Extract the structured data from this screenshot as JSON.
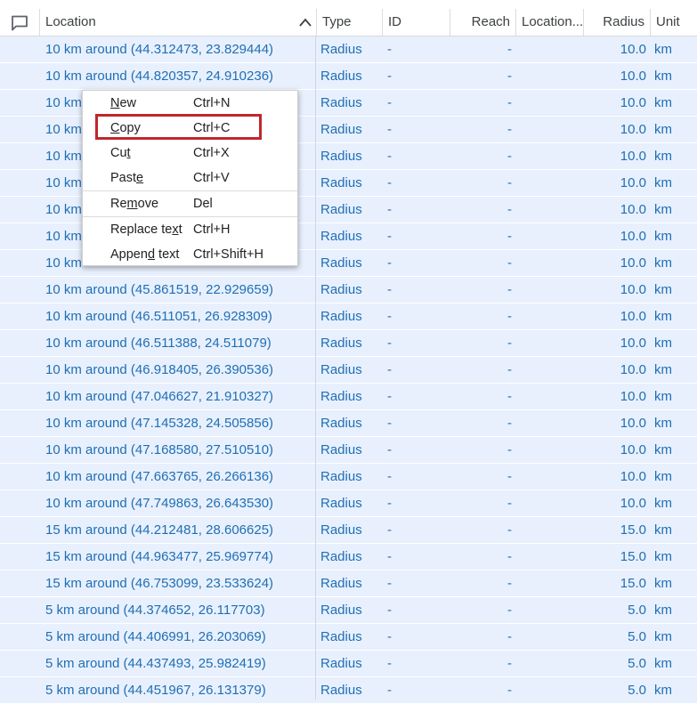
{
  "columns": {
    "location": "Location",
    "type": "Type",
    "id": "ID",
    "reach": "Reach",
    "location_groups": "Location...",
    "radius": "Radius",
    "unit": "Unit"
  },
  "rows": [
    {
      "location": "10 km around (44.312473, 23.829444)",
      "type": "Radius",
      "id": "-",
      "reach": "-",
      "radius": "10.0",
      "unit": "km"
    },
    {
      "location": "10 km around (44.820357, 24.910236)",
      "type": "Radius",
      "id": "-",
      "reach": "-",
      "radius": "10.0",
      "unit": "km"
    },
    {
      "location": "10 km",
      "type": "Radius",
      "id": "-",
      "reach": "-",
      "radius": "10.0",
      "unit": "km"
    },
    {
      "location": "10 km",
      "type": "Radius",
      "id": "-",
      "reach": "-",
      "radius": "10.0",
      "unit": "km"
    },
    {
      "location": "10 km",
      "type": "Radius",
      "id": "-",
      "reach": "-",
      "radius": "10.0",
      "unit": "km"
    },
    {
      "location": "10 km",
      "type": "Radius",
      "id": "-",
      "reach": "-",
      "radius": "10.0",
      "unit": "km"
    },
    {
      "location": "10 km",
      "type": "Radius",
      "id": "-",
      "reach": "-",
      "radius": "10.0",
      "unit": "km"
    },
    {
      "location": "10 km",
      "type": "Radius",
      "id": "-",
      "reach": "-",
      "radius": "10.0",
      "unit": "km"
    },
    {
      "location": "10 km",
      "type": "Radius",
      "id": "-",
      "reach": "-",
      "radius": "10.0",
      "unit": "km"
    },
    {
      "location": "10 km around (45.861519, 22.929659)",
      "type": "Radius",
      "id": "-",
      "reach": "-",
      "radius": "10.0",
      "unit": "km"
    },
    {
      "location": "10 km around (46.511051, 26.928309)",
      "type": "Radius",
      "id": "-",
      "reach": "-",
      "radius": "10.0",
      "unit": "km"
    },
    {
      "location": "10 km around (46.511388, 24.511079)",
      "type": "Radius",
      "id": "-",
      "reach": "-",
      "radius": "10.0",
      "unit": "km"
    },
    {
      "location": "10 km around (46.918405, 26.390536)",
      "type": "Radius",
      "id": "-",
      "reach": "-",
      "radius": "10.0",
      "unit": "km"
    },
    {
      "location": "10 km around (47.046627, 21.910327)",
      "type": "Radius",
      "id": "-",
      "reach": "-",
      "radius": "10.0",
      "unit": "km"
    },
    {
      "location": "10 km around (47.145328, 24.505856)",
      "type": "Radius",
      "id": "-",
      "reach": "-",
      "radius": "10.0",
      "unit": "km"
    },
    {
      "location": "10 km around (47.168580, 27.510510)",
      "type": "Radius",
      "id": "-",
      "reach": "-",
      "radius": "10.0",
      "unit": "km"
    },
    {
      "location": "10 km around (47.663765, 26.266136)",
      "type": "Radius",
      "id": "-",
      "reach": "-",
      "radius": "10.0",
      "unit": "km"
    },
    {
      "location": "10 km around (47.749863, 26.643530)",
      "type": "Radius",
      "id": "-",
      "reach": "-",
      "radius": "10.0",
      "unit": "km"
    },
    {
      "location": "15 km around (44.212481, 28.606625)",
      "type": "Radius",
      "id": "-",
      "reach": "-",
      "radius": "15.0",
      "unit": "km"
    },
    {
      "location": "15 km around (44.963477, 25.969774)",
      "type": "Radius",
      "id": "-",
      "reach": "-",
      "radius": "15.0",
      "unit": "km"
    },
    {
      "location": "15 km around (46.753099, 23.533624)",
      "type": "Radius",
      "id": "-",
      "reach": "-",
      "radius": "15.0",
      "unit": "km"
    },
    {
      "location": "5 km around (44.374652, 26.117703)",
      "type": "Radius",
      "id": "-",
      "reach": "-",
      "radius": "5.0",
      "unit": "km"
    },
    {
      "location": "5 km around (44.406991, 26.203069)",
      "type": "Radius",
      "id": "-",
      "reach": "-",
      "radius": "5.0",
      "unit": "km"
    },
    {
      "location": "5 km around (44.437493, 25.982419)",
      "type": "Radius",
      "id": "-",
      "reach": "-",
      "radius": "5.0",
      "unit": "km"
    },
    {
      "location": "5 km around (44.451967, 26.131379)",
      "type": "Radius",
      "id": "-",
      "reach": "-",
      "radius": "5.0",
      "unit": "km"
    }
  ],
  "context_menu": {
    "items": [
      {
        "label": "New",
        "shortcut": "Ctrl+N"
      },
      {
        "label": "Copy",
        "shortcut": "Ctrl+C"
      },
      {
        "label": "Cut",
        "shortcut": "Ctrl+X"
      },
      {
        "label": "Paste",
        "shortcut": "Ctrl+V"
      },
      {
        "label": "Remove",
        "shortcut": "Del"
      },
      {
        "label": "Replace text",
        "shortcut": "Ctrl+H"
      },
      {
        "label": "Append text",
        "shortcut": "Ctrl+Shift+H"
      }
    ]
  },
  "colors": {
    "row_selected": "#e8f0fe",
    "link_text": "#1f6fb4",
    "highlight_box": "#c0272d"
  },
  "icons": {
    "comment": "comment-icon",
    "sort": "chevron-up-icon"
  }
}
